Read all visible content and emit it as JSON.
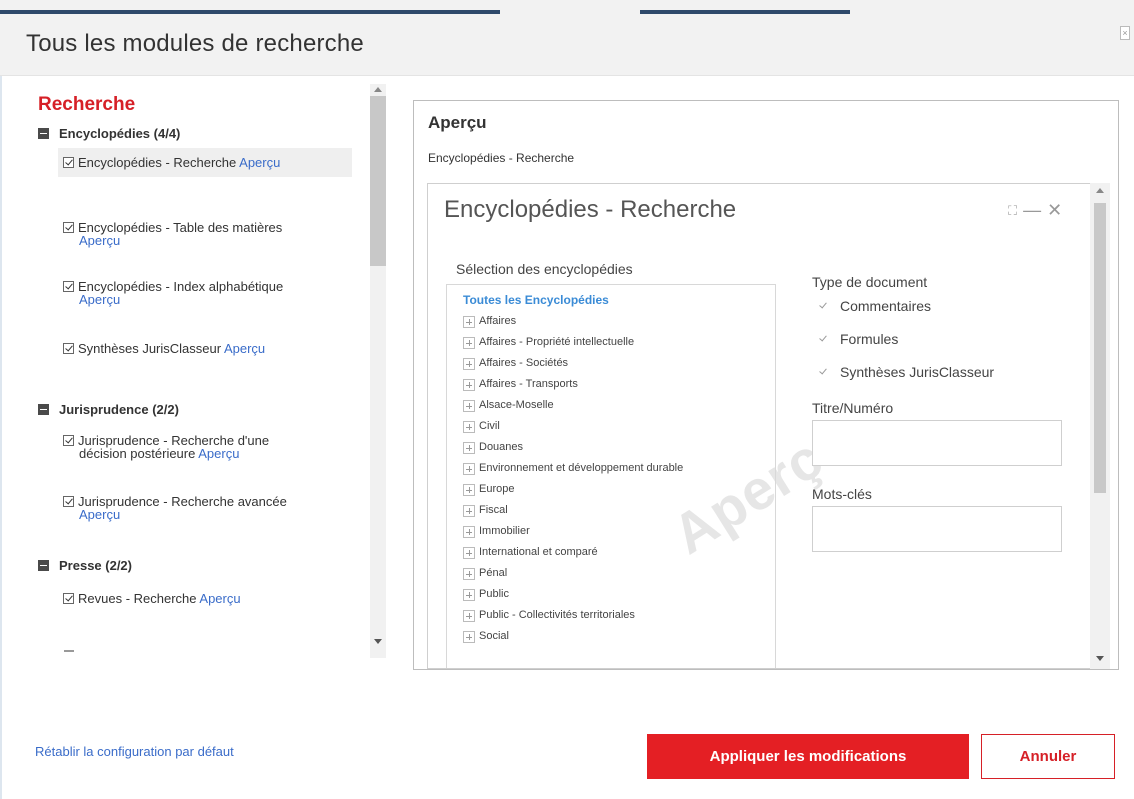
{
  "dialog": {
    "title": "Tous les modules de recherche",
    "close_glyph": "×"
  },
  "left": {
    "section_title": "Recherche",
    "preview_link": "Aperçu",
    "groups": [
      {
        "label": "Encyclopédies (4/4)",
        "items": [
          {
            "label": "Encyclopédies - Recherche",
            "checked": true,
            "selected": true
          },
          {
            "label": "Encyclopédies - Table des matières",
            "checked": true
          },
          {
            "label": "Encyclopédies - Index alphabétique",
            "checked": true
          },
          {
            "label": "Synthèses JurisClasseur",
            "checked": true
          }
        ]
      },
      {
        "label": "Jurisprudence (2/2)",
        "items": [
          {
            "label": "Jurisprudence - Recherche d'une",
            "label_line2": "décision postérieure",
            "checked": true
          },
          {
            "label": "Jurisprudence - Recherche avancée",
            "checked": true
          }
        ]
      },
      {
        "label": "Presse (2/2)",
        "items": [
          {
            "label": "Revues - Recherche",
            "checked": true
          }
        ]
      }
    ]
  },
  "preview": {
    "title": "Aperçu",
    "subtitle": "Encyclopédies - Recherche",
    "watermark": "Aperçu",
    "module": {
      "title": "Encyclopédies - Recherche",
      "controls": {
        "expand": "⛶",
        "minimize": "—",
        "close": "✕"
      },
      "selection_label": "Sélection des encyclopédies",
      "all_label": "Toutes les Encyclopédies",
      "tree": [
        "Affaires",
        "Affaires - Propriété intellectuelle",
        "Affaires - Sociétés",
        "Affaires - Transports",
        "Alsace-Moselle",
        "Civil",
        "Douanes",
        "Environnement et développement durable",
        "Europe",
        "Fiscal",
        "Immobilier",
        "International et comparé",
        "Pénal",
        "Public",
        "Public - Collectivités territoriales",
        "Social"
      ],
      "doc_type_label": "Type de document",
      "doc_types": [
        "Commentaires",
        "Formules",
        "Synthèses JurisClasseur"
      ],
      "title_field_label": "Titre/Numéro",
      "keywords_label": "Mots-clés"
    }
  },
  "footer": {
    "reset_label": "Rétablir la configuration par défaut",
    "apply_label": "Appliquer les modifications",
    "cancel_label": "Annuler"
  },
  "colors": {
    "accent_red": "#e41f24",
    "link_blue": "#3a6cc9",
    "tree_link_blue": "#3a8bd6"
  }
}
